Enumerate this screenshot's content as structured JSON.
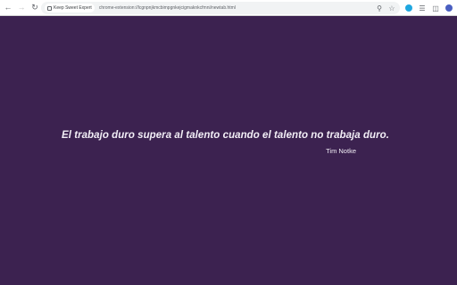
{
  "browser": {
    "nav": {
      "back_icon": "arrow-left-icon",
      "forward_icon": "arrow-right-icon",
      "reload_icon": "reload-icon"
    },
    "omnibox": {
      "site_chip_label": "Keep Sweet Expert",
      "url": "chrome-extension://lcgnpnjkmcbimpgnkejcigmaknkcfmni/newtab.html"
    },
    "icons": [
      "zoom-icon",
      "bookmark-star-icon",
      "extension-icon",
      "puzzle-icon",
      "sidebar-icon",
      "profile-avatar-icon"
    ]
  },
  "quote": {
    "text": "El trabajo duro supera al talento cuando el talento no trabaja duro.",
    "author": "Tim Notke"
  },
  "colors": {
    "background": "#3c2250",
    "text": "#f2eef6",
    "toolbar": "#ffffff",
    "extension_accent": "#1fa7e0"
  }
}
